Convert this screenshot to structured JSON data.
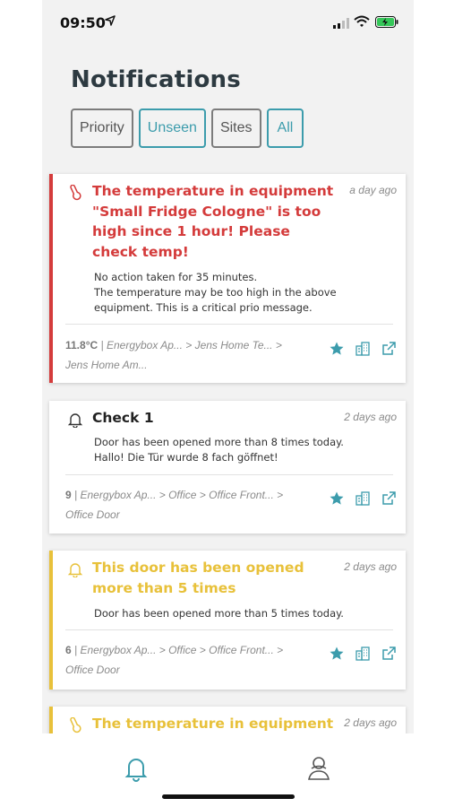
{
  "status_bar": {
    "time": "09:50"
  },
  "title": "Notifications",
  "filters": [
    {
      "label": "Priority",
      "active": false
    },
    {
      "label": "Unseen",
      "active": true
    },
    {
      "label": "Sites",
      "active": false
    },
    {
      "label": "All",
      "active": true
    }
  ],
  "colors": {
    "critical": "#d43b3b",
    "warning": "#e8c13a",
    "accent": "#3c9cac",
    "title": "#2d3a41"
  },
  "notifications": [
    {
      "severity": "critical",
      "icon": "thermometer-icon",
      "title": "The temperature in equipment \"Small Fridge Cologne\" is too high since 1 hour! Please check temp!",
      "time": "a day ago",
      "body": "No action taken for 35 minutes.\nThe temperature may be too high in the above equipment. This is a critical prio message.",
      "value": "11.8°C",
      "path": "Energybox Ap... > Jens Home Te... > Jens Home Am..."
    },
    {
      "severity": "info",
      "icon": "bell-icon",
      "title": "Check 1",
      "time": "2 days ago",
      "body": "Door has been opened more than 8 times today.\nHallo! Die Tür wurde 8 fach göffnet!",
      "value": "9",
      "path": "Energybox Ap... > Office > Office Front... > Office Door"
    },
    {
      "severity": "warning",
      "icon": "bell-icon",
      "title": "This door has been opened more than 5 times",
      "time": "2 days ago",
      "body": "Door has been opened more than 5 times today.",
      "value": "6",
      "path": "Energybox Ap... > Office > Office Front... > Office Door"
    },
    {
      "severity": "warning",
      "icon": "thermometer-icon",
      "title": "The temperature in equipment",
      "time": "2 days ago"
    }
  ],
  "tabs": [
    {
      "name": "notifications",
      "icon": "bell-icon",
      "active": true
    },
    {
      "name": "profile",
      "icon": "user-icon",
      "active": false
    }
  ]
}
